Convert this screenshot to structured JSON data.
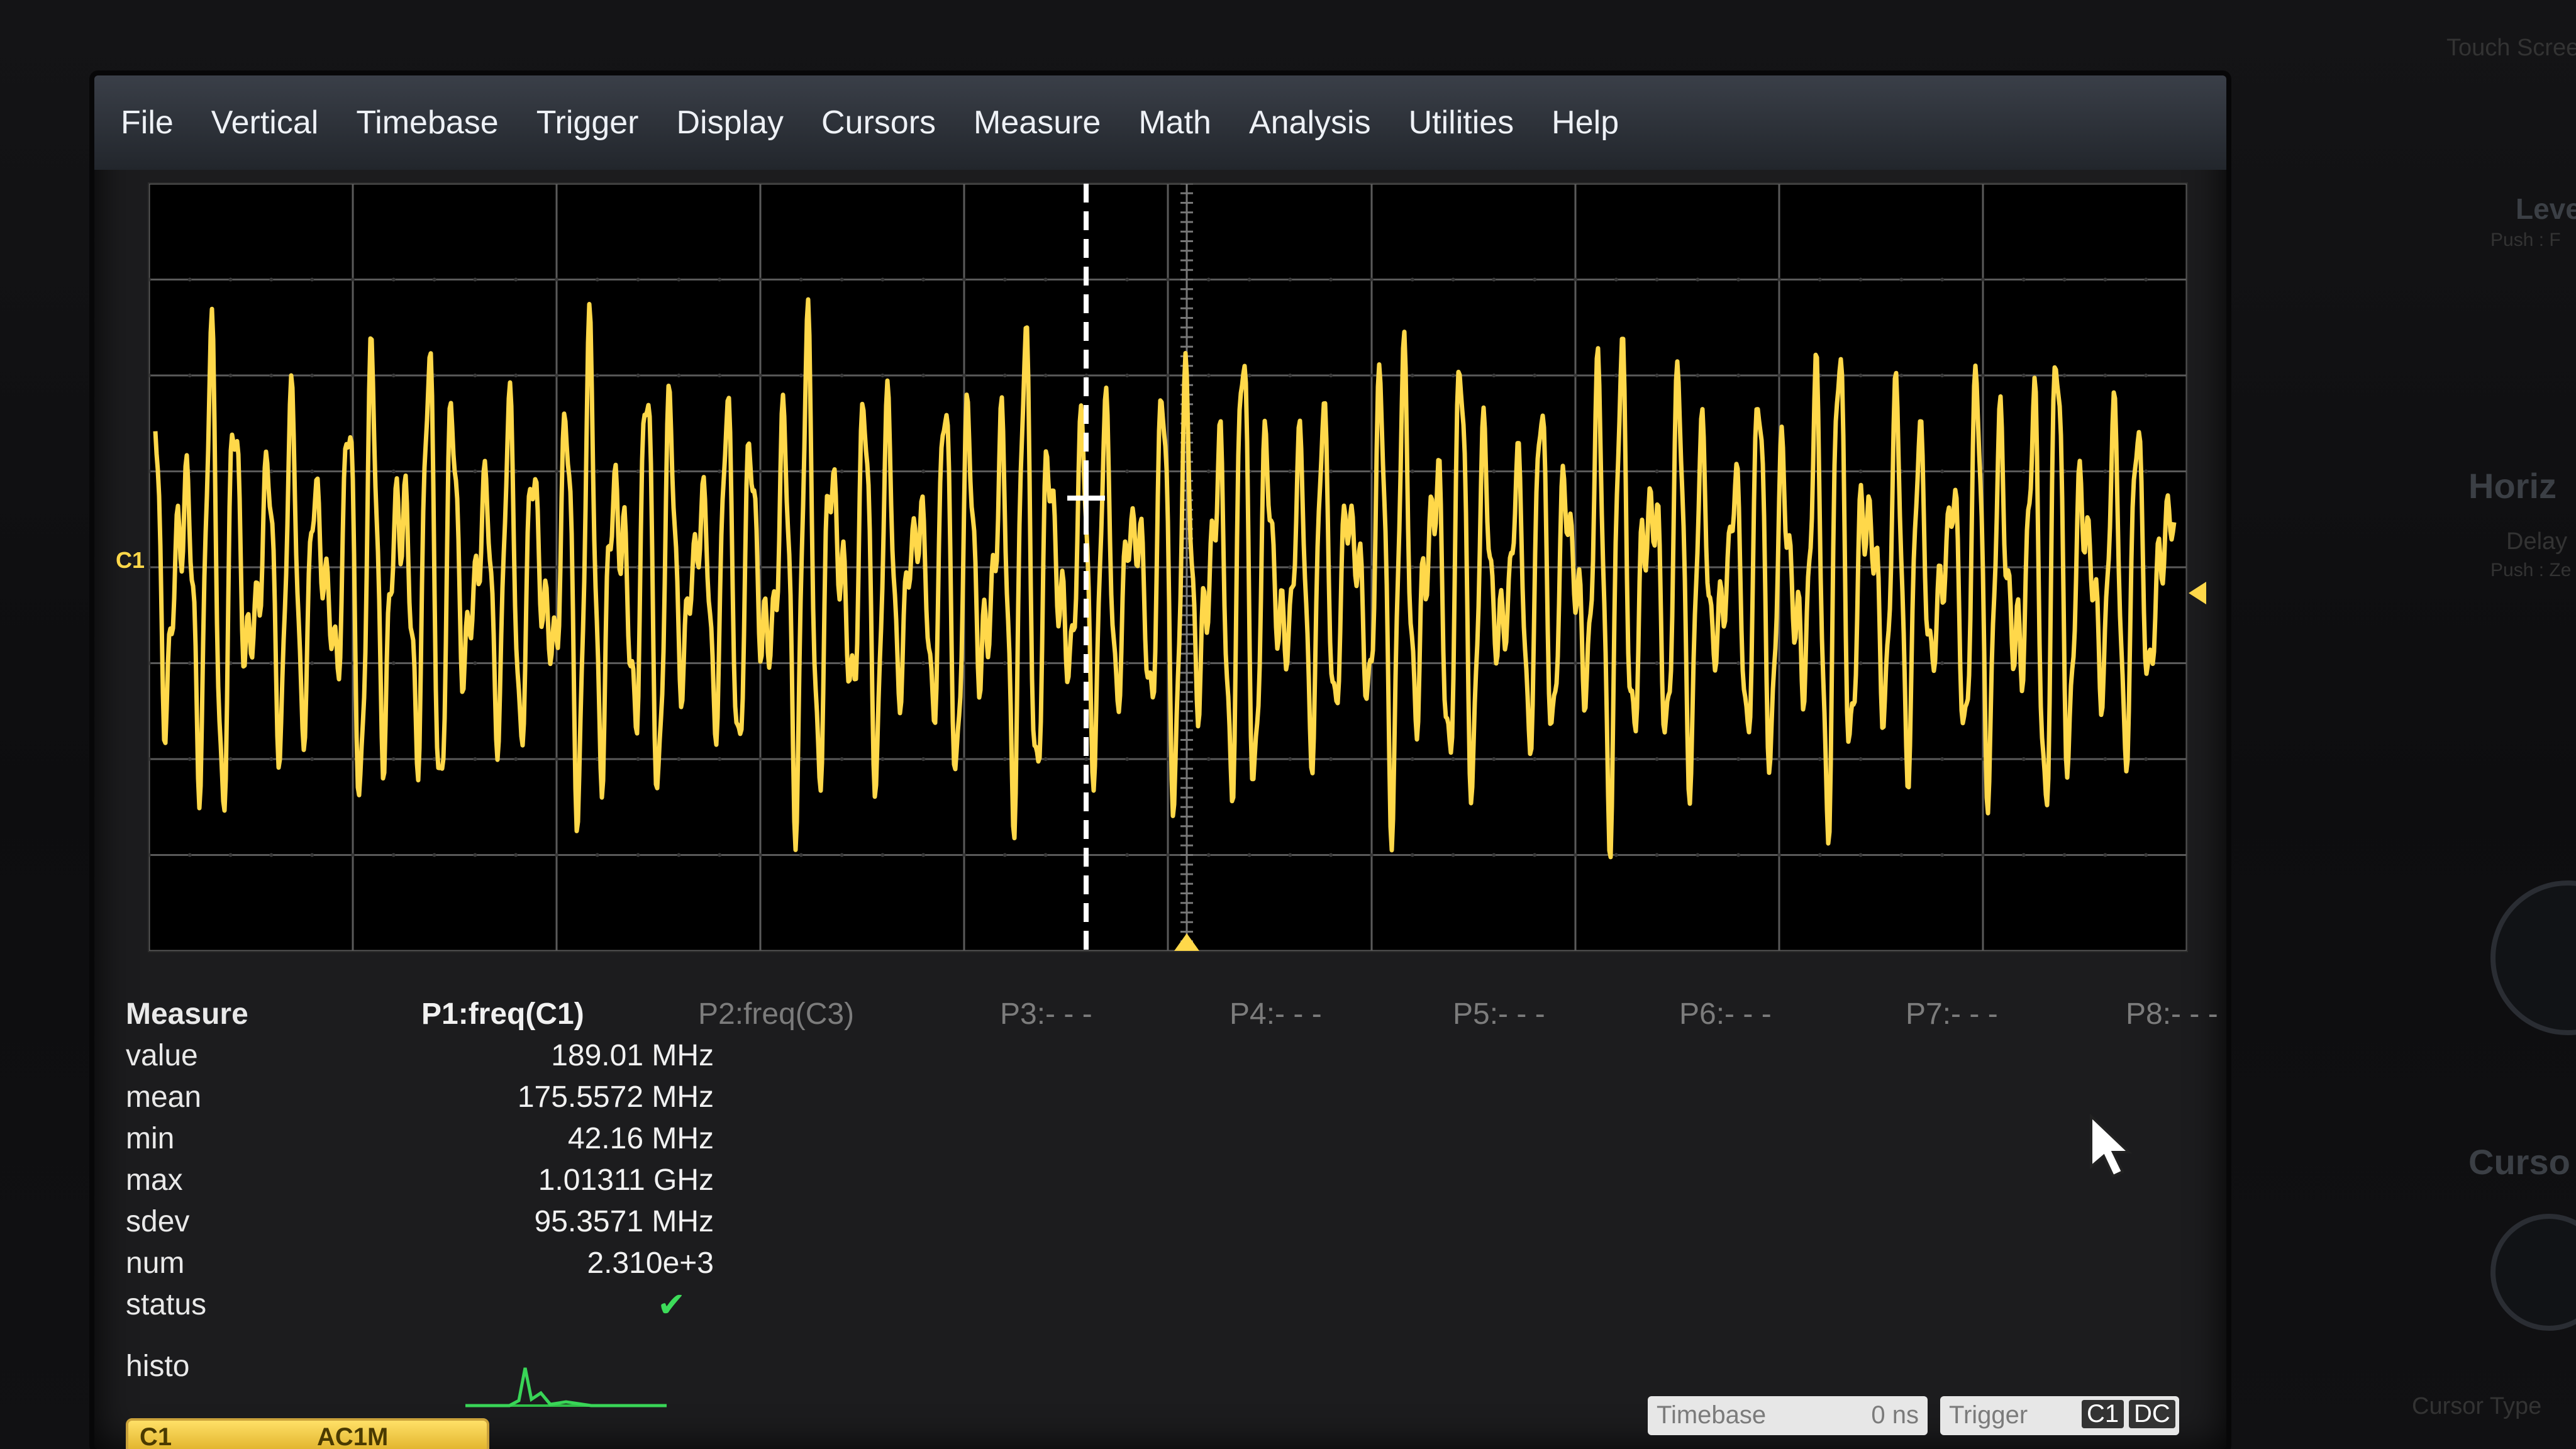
{
  "menu": [
    "File",
    "Vertical",
    "Timebase",
    "Trigger",
    "Display",
    "Cursors",
    "Measure",
    "Math",
    "Analysis",
    "Utilities",
    "Help"
  ],
  "channel_marker": "C1",
  "params": [
    {
      "label": "P1:freq(C1)",
      "active": true
    },
    {
      "label": "P2:freq(C3)",
      "active": false
    },
    {
      "label": "P3:- - -",
      "active": false
    },
    {
      "label": "P4:- - -",
      "active": false
    },
    {
      "label": "P5:- - -",
      "active": false
    },
    {
      "label": "P6:- - -",
      "active": false
    },
    {
      "label": "P7:- - -",
      "active": false
    },
    {
      "label": "P8:- - -",
      "active": false
    }
  ],
  "measure": {
    "title": "Measure",
    "rows": [
      {
        "label": "value",
        "value": "189.01 MHz"
      },
      {
        "label": "mean",
        "value": "175.5572 MHz"
      },
      {
        "label": "min",
        "value": "42.16 MHz"
      },
      {
        "label": "max",
        "value": "1.01311 GHz"
      },
      {
        "label": "sdev",
        "value": "95.3571 MHz"
      },
      {
        "label": "num",
        "value": "2.310e+3"
      },
      {
        "label": "status",
        "value": ""
      },
      {
        "label": "histo",
        "value": ""
      }
    ]
  },
  "channel_badge": {
    "name": "C1",
    "coupling": "AC1M"
  },
  "timebase_box": {
    "title": "Timebase",
    "value": "0 ns"
  },
  "trigger_box": {
    "title": "Trigger",
    "source": "C1",
    "coupling": "DC"
  },
  "side_panel": {
    "touch": "Touch Screen",
    "level": "Leve",
    "level_sub": "Push : F",
    "horizontal": "Horiz",
    "delay": "Delay",
    "delay_sub": "Push : Ze",
    "cursors": "Curso",
    "cursor_type": "Cursor Type"
  },
  "colors": {
    "trace": "#ffd84a",
    "grid": "#5a5a5a",
    "menu_bg": "#2b3037",
    "text": "#f1f1f1"
  }
}
